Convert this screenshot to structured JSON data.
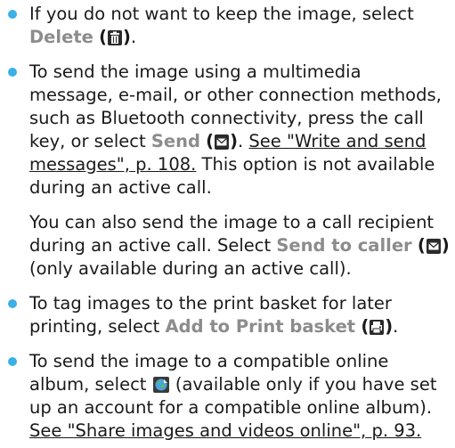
{
  "colors": {
    "bullet": "#3bb0e6",
    "ui_label": "#8c8c8c",
    "text": "#1a1a1a",
    "icon_dark": "#2a2a2a"
  },
  "items": [
    {
      "t1": "If you do not want to keep the image, select ",
      "ui1": "Delete",
      "icon1": "trash-can-icon",
      "t2": "."
    },
    {
      "t1": "To send the image using a multimedia message, e-mail, or other connection methods, such as Bluetooth connectivity, press the call key, or select ",
      "ui1": "Send",
      "icon1": "envelope-icon",
      "t2": ". ",
      "link1": "See \"Write and send messages\", p. 108.",
      "t3": " This option is not available during an active call.",
      "p2_t1": "You can also send the image to a call recipient during an active call. Select ",
      "p2_ui1": "Send to caller",
      "p2_icon1": "envelope-icon",
      "p2_t2": " (only available during an active call)."
    },
    {
      "t1": "To tag images to the print basket for later printing, select ",
      "ui1": "Add to Print basket",
      "icon1": "print-basket-icon",
      "t2": "."
    },
    {
      "t1": "To send the image to a compatible online album, select ",
      "icon1": "online-share-globe-icon",
      "t2": " (available only if you have set up an account for a compatible online album). ",
      "link1": "See \"Share images and videos online\", p. 93."
    }
  ]
}
